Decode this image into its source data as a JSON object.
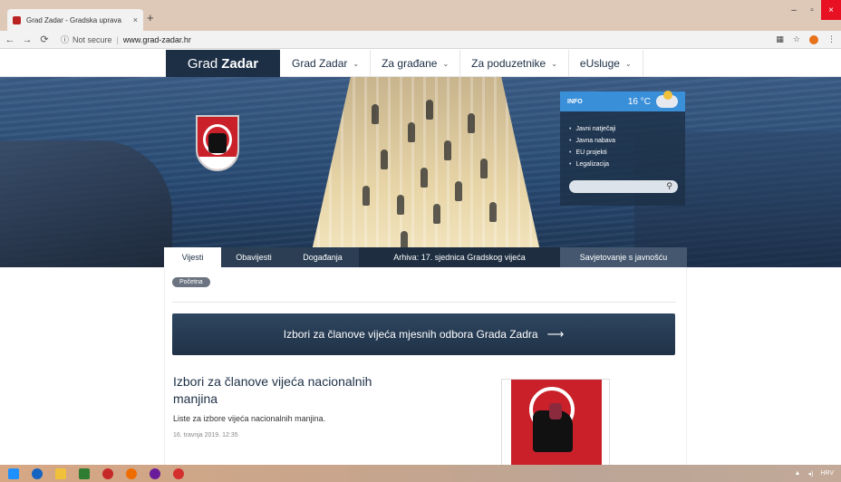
{
  "browser": {
    "tab_title": "Grad Zadar - Gradska uprava",
    "tab_close": "×",
    "new_tab": "+",
    "address": {
      "security_label": "Not secure",
      "host": "www.grad-zadar.hr"
    },
    "window_controls": {
      "minimize": "–",
      "maximize": "▫",
      "close": "×"
    },
    "nav_icons": [
      "arrow-left-icon",
      "arrow-right-icon",
      "reload-icon"
    ]
  },
  "site": {
    "brand_light": "Grad",
    "brand_bold": "Zadar",
    "menu": [
      {
        "label": "Grad Zadar"
      },
      {
        "label": "Za građane"
      },
      {
        "label": "Za poduzetnike"
      },
      {
        "label": "eUsluge"
      }
    ],
    "info": {
      "title": "INFO",
      "temperature": "16 °C",
      "links": [
        "Javni natječaji",
        "Javna nabava",
        "EU projekti",
        "Legalizacija"
      ]
    },
    "news_tabs": [
      "Vijesti",
      "Obavijesti",
      "Događanja",
      "Arhiva: 17. sjednica Gradskog vijeća",
      "Savjetovanje s javnošću"
    ],
    "breadcrumb": "Početna",
    "banner": {
      "text": "Izbori za članove vijeća mjesnih odbora Grada Zadra",
      "arrow": "⟶"
    },
    "article": {
      "title": "Izbori za članove vijeća nacionalnih manjina",
      "subtitle": "Liste za izbore vijeća nacionalnih manjina.",
      "date": "16. travnja 2019. 12:35"
    }
  },
  "taskbar": {
    "apps": [
      "windows-start-icon",
      "edge-icon",
      "file-explorer-icon",
      "store-icon",
      "opera-icon",
      "app-icon",
      "chrome-alt-icon",
      "chrome-icon"
    ],
    "language": "HRV",
    "colors": [
      "#1e90ff",
      "#1565c0",
      "#f2c13b",
      "#2e7d32",
      "#c62828",
      "#ef6c00",
      "#6a1b9a",
      "#d32f2f"
    ]
  },
  "colors": {
    "brand_navy": "#1c2f45",
    "info_blue": "#3a8fd9",
    "crest_red": "#c9202a"
  }
}
